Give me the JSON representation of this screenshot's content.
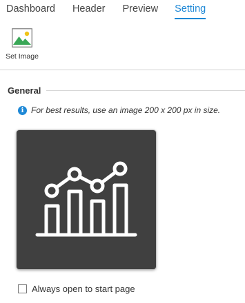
{
  "tabs": [
    {
      "label": "Dashboard"
    },
    {
      "label": "Header"
    },
    {
      "label": "Preview"
    },
    {
      "label": "Setting"
    }
  ],
  "active_tab": "Setting",
  "ribbon": {
    "set_image": {
      "label": "Set Image",
      "icon": "image-icon"
    }
  },
  "general": {
    "title": "General",
    "info_icon": "info-icon",
    "info_text": "For best results, use an image 200 x 200 px in size.",
    "image_icon": "bar-line-chart-icon"
  },
  "always_open": {
    "label": "Always open to start page",
    "checked": false
  },
  "colors": {
    "accent": "#1e88d6",
    "image_bg": "#404040",
    "icon_green": "#3aa757",
    "icon_sun": "#f0c419"
  }
}
